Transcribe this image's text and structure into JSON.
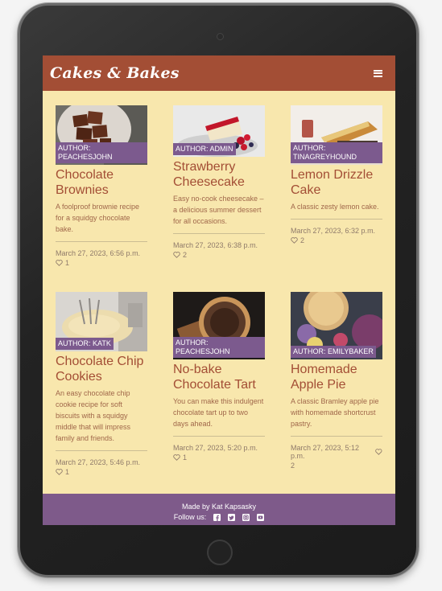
{
  "brand": "Cakes & Bakes",
  "cards": [
    {
      "author": "AUTHOR: PEACHESJOHN",
      "title": "Chocolate Brownies",
      "desc": "A foolproof brownie recipe for a squidgy chocolate bake.",
      "date": "March 27, 2023, 6:56 p.m.",
      "likes": "1",
      "image": "brownies-photo"
    },
    {
      "author": "AUTHOR: ADMIN",
      "title": "Strawberry Cheesecake",
      "desc": "Easy no-cook cheesecake – a delicious summer dessert for all occasions.",
      "date": "March 27, 2023, 6:38 p.m.",
      "likes": "2",
      "image": "cheesecake-photo"
    },
    {
      "author": "AUTHOR: TINAGREYHOUND",
      "title": "Lemon Drizzle Cake",
      "desc": "A classic zesty lemon cake.",
      "date": "March 27, 2023, 6:32 p.m.",
      "likes": "2",
      "image": "lemon-cake-photo"
    },
    {
      "author": "AUTHOR: KATK",
      "title": "Chocolate Chip Cookies",
      "desc": "An easy chocolate chip cookie recipe for soft biscuits with a squidgy middle that will impress family and friends.",
      "date": "March 27, 2023, 5:46 p.m.",
      "likes": "1",
      "image": "cookie-baking-photo"
    },
    {
      "author": "AUTHOR: PEACHESJOHN",
      "title": "No-bake Chocolate Tart",
      "desc": "You can make this indulgent chocolate tart up to two days ahead.",
      "date": "March 27, 2023, 5:20 p.m.",
      "likes": "1",
      "image": "chocolate-tart-photo"
    },
    {
      "author": "AUTHOR: EMILYBAKER",
      "title": "Homemade Apple Pie",
      "desc": "A classic Bramley apple pie with homemade shortcrust pastry.",
      "date": "March 27, 2023, 5:12 p.m.",
      "likes": "2",
      "image": "apple-pie-photo"
    }
  ],
  "footer": {
    "made_by": "Made by Kat Kapsasky",
    "follow_label": "Follow us:",
    "social_icons": [
      "facebook-icon",
      "twitter-icon",
      "instagram-icon",
      "youtube-icon"
    ]
  },
  "colors": {
    "navbar": "#a34e35",
    "page_bg": "#f8e7ad",
    "footer": "#7e5a8a",
    "badge": "#7c5a8e",
    "title": "#a34e35"
  }
}
